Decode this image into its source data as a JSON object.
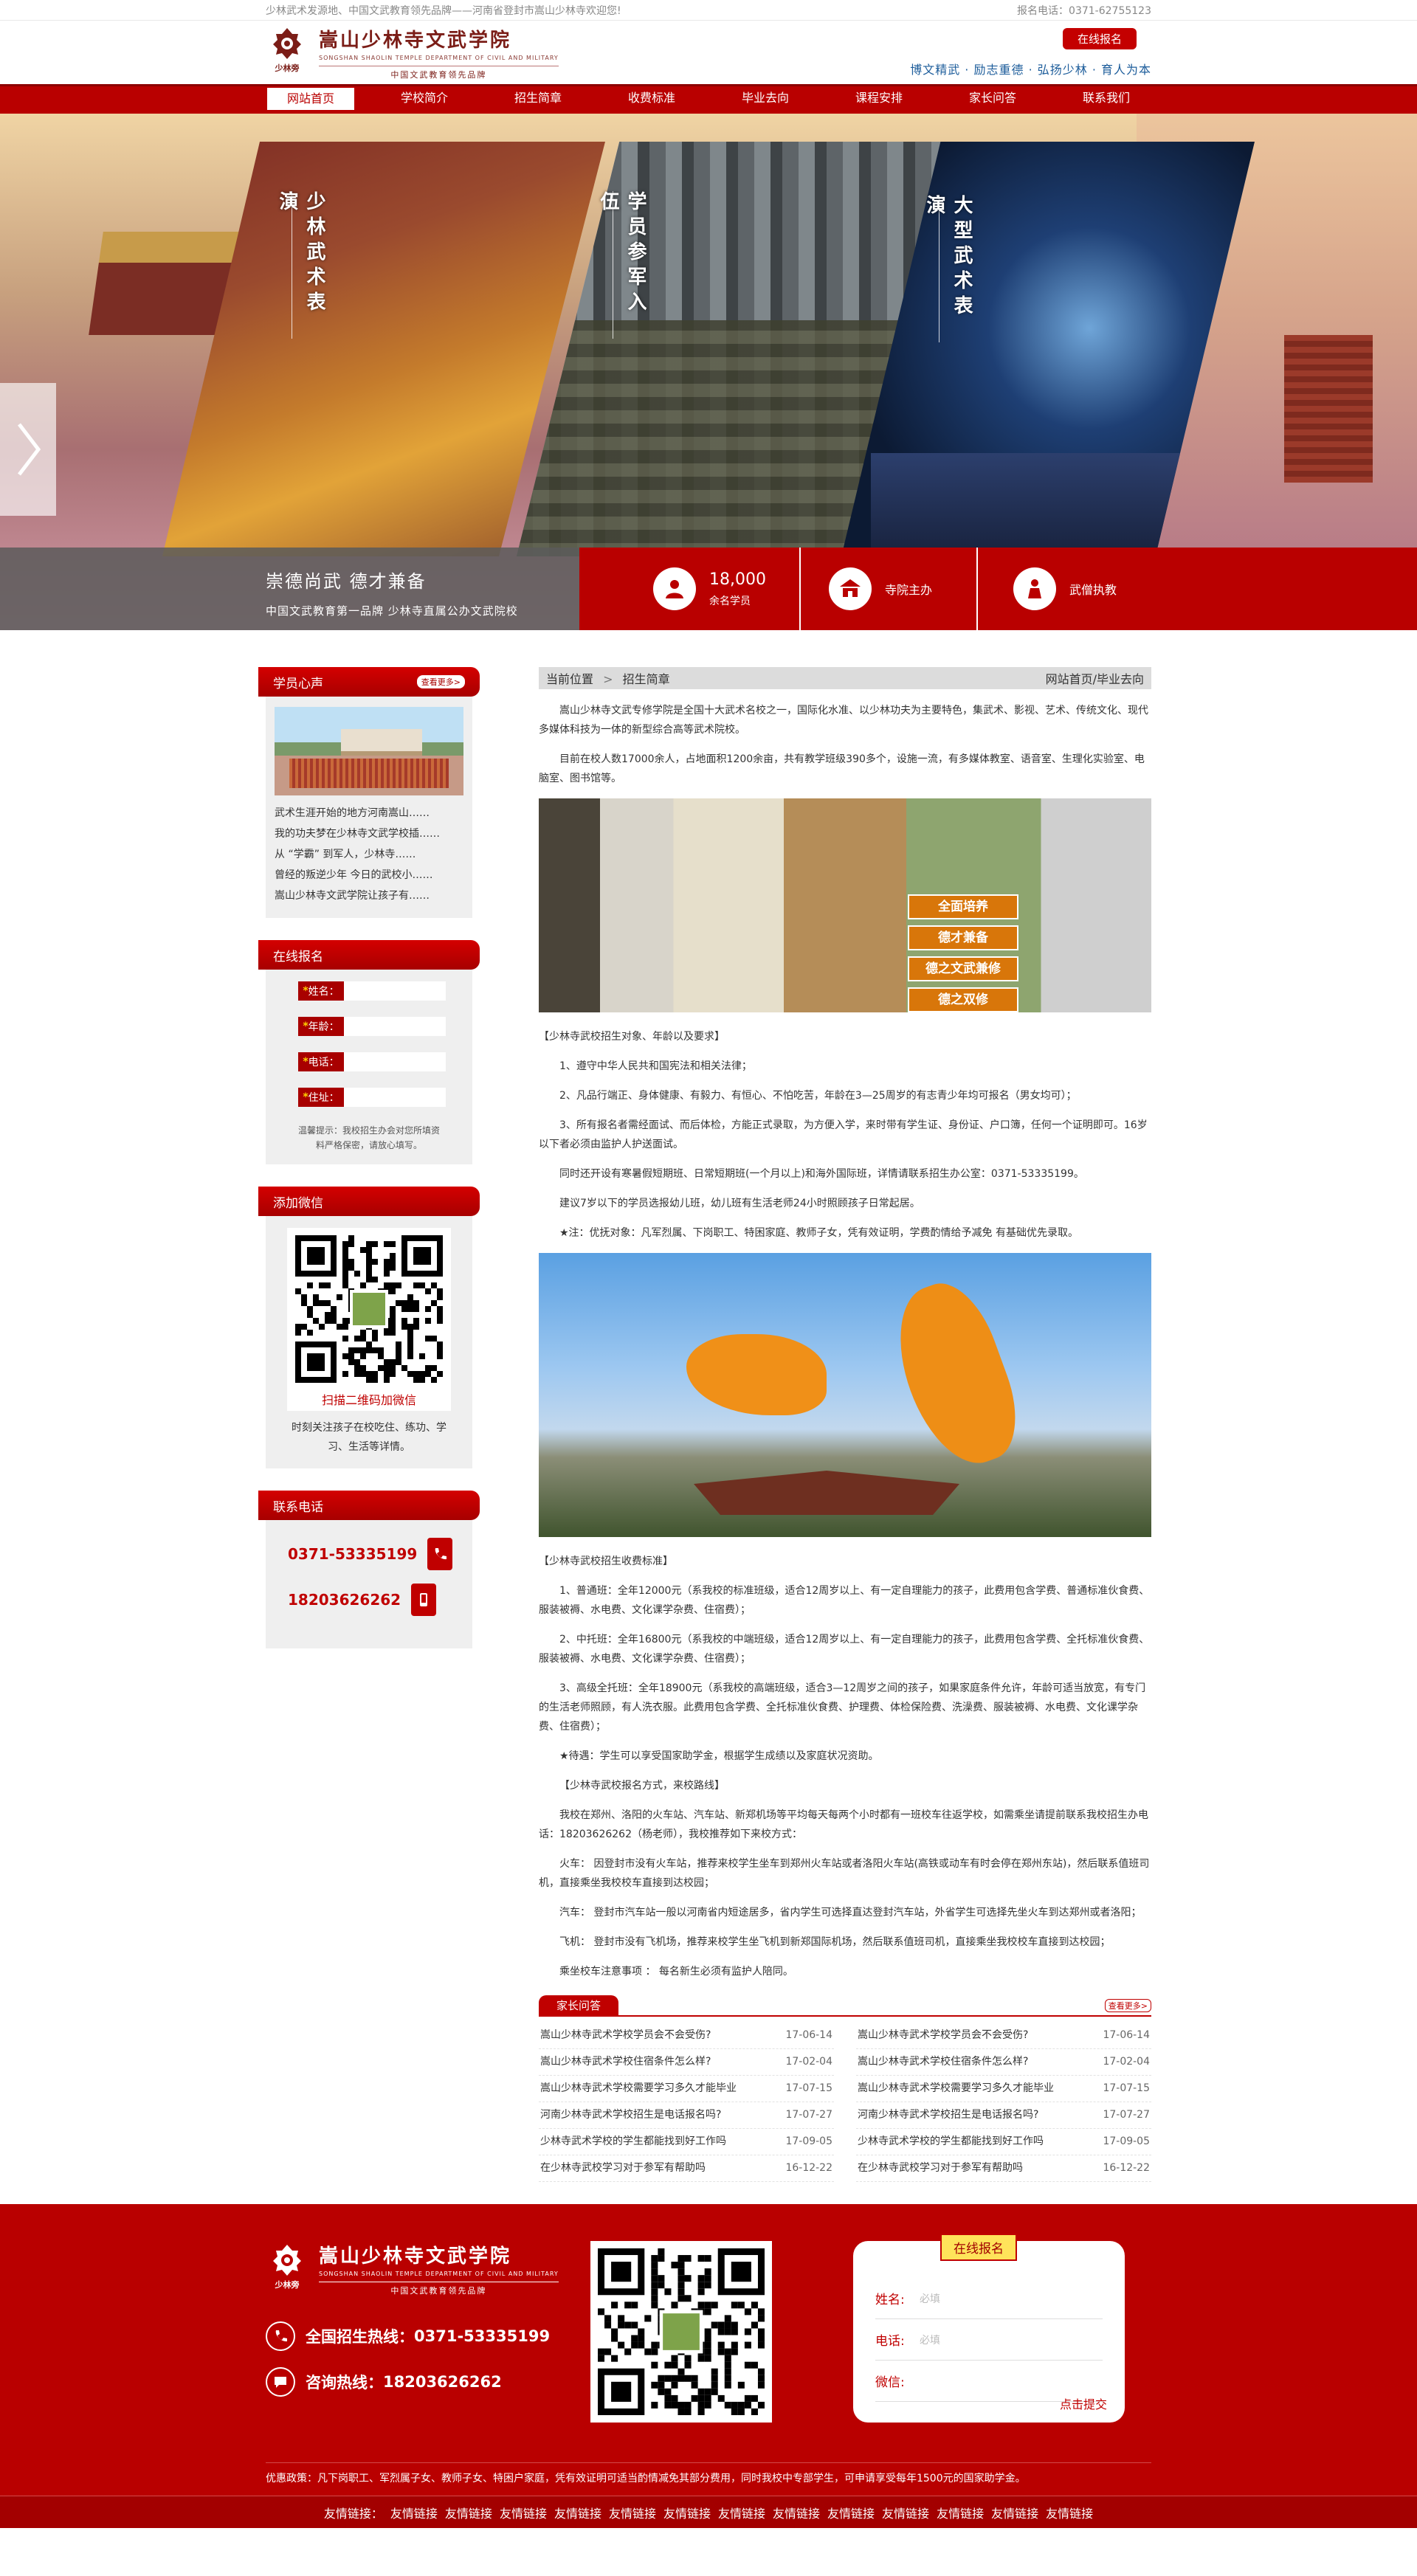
{
  "topbar": {
    "left": "少林武术发源地、中国文武教育领先品牌——河南省登封市嵩山少林寺欢迎您!",
    "right": "报名电话：0371-62755123"
  },
  "header": {
    "school_name": "嵩山少林寺文武学院",
    "school_name_en": "SONGSHAN SHAOLIN TEMPLE DEPARTMENT OF CIVIL AND MILITARY",
    "slogan": "中国文武教育领先品牌",
    "seal_text": "少林旁",
    "apply_label": "在线报名",
    "motto": "博文精武 · 励志重德 · 弘扬少林 · 育人为本"
  },
  "nav": {
    "items": [
      {
        "label": "网站首页"
      },
      {
        "label": "学校简介"
      },
      {
        "label": "招生简章"
      },
      {
        "label": "收费标准"
      },
      {
        "label": "毕业去向"
      },
      {
        "label": "课程安排"
      },
      {
        "label": "家长问答"
      },
      {
        "label": "联系我们"
      }
    ]
  },
  "hero": {
    "panels": [
      {
        "title": "少林武术表演"
      },
      {
        "title": "学员参军入伍"
      },
      {
        "title": "大型武术表演"
      }
    ],
    "tagline": "崇德尚武  德才兼备",
    "subline": "中国文武教育第一品牌    少林寺直属公办文武院校",
    "stat_number": "18,000",
    "stat_label": "余名学员",
    "feature_2": "寺院主办",
    "feature_3": "武僧执教"
  },
  "sidebar": {
    "testimonials": {
      "title": "学员心声",
      "more": "查看更多>",
      "items": [
        "武术生涯开始的地方河南嵩山……",
        "我的功夫梦在少林寺文武学校插……",
        "从 “学霸” 到军人，少林寺……",
        "曾经的叛逆少年 今日的武校小……",
        "嵩山少林寺文武学院让孩子有……"
      ]
    },
    "signup": {
      "title": "在线报名",
      "fields": [
        {
          "label": "姓名："
        },
        {
          "label": "年龄："
        },
        {
          "label": "电话："
        },
        {
          "label": "住址："
        }
      ],
      "required_mark": "*",
      "tip": "温馨提示：我校招生办会对您所填资料严格保密，请放心填写。"
    },
    "wechat": {
      "title": "添加微信",
      "caption": "扫描二维码加微信",
      "desc": "时刻关注孩子在校吃住、练功、学习、生活等详情。"
    },
    "contact": {
      "title": "联系电话",
      "phone1": "0371-53335199",
      "phone2": "18203626262"
    }
  },
  "content": {
    "crumb_label": "当前位置",
    "crumb_current": "招生简章",
    "crumb_right": "网站首页/毕业去向",
    "intro1": "嵩山少林寺文武专修学院是全国十大武术名校之一，国际化水准、以少林功夫为主要特色，集武术、影视、艺术、传统文化、现代多媒体科技为一体的新型综合高等武术院校。",
    "intro2": "目前在校人数17000余人，占地面积1200余亩，共有教学班级390多个，设施一流，有多媒体教室、语音室、生理化实验室、电脑室、图书馆等。",
    "photo1_banners": [
      "全面培养",
      "德才兼备",
      "德之文武兼修",
      "德之双修"
    ],
    "req_title": "【少林寺武校招生对象、年龄以及要求】",
    "req1": "1、遵守中华人民共和国宪法和相关法律；",
    "req2": "2、凡品行端正、身体健康、有毅力、有恒心、不怕吃苦，年龄在3—25周岁的有志青少年均可报名（男女均可）；",
    "req3": "3、所有报名者需经面试、而后体检，方能正式录取，为方便入学，来时带有学生证、身份证、户口簿，任何一个证明即可。16岁以下者必须由监护人护送面试。",
    "req4": "同时还开设有寒暑假短期班、日常短期班(一个月以上)和海外国际班，详情请联系招生办公室：0371-53335199。",
    "req5": "建议7岁以下的学员选报幼儿班，幼儿班有生活老师24小时照顾孩子日常起居。",
    "req6": "★注：优抚对象：凡军烈属、下岗职工、特困家庭、教师子女，凭有效证明，学费酌情给予减免 有基础优先录取。",
    "fee_title": "【少林寺武校招生收费标准】",
    "fee1": "1、普通班：全年12000元（系我校的标准班级，适合12周岁以上、有一定自理能力的孩子，此费用包含学费、普通标准伙食费、服装被褥、水电费、文化课学杂费、住宿费）；",
    "fee2": "2、中托班：全年16800元（系我校的中端班级，适合12周岁以上、有一定自理能力的孩子，此费用包含学费、全托标准伙食费、服装被褥、水电费、文化课学杂费、住宿费）；",
    "fee3": "3、高级全托班：全年18900元（系我校的高端班级，适合3—12周岁之间的孩子，如果家庭条件允许，年龄可适当放宽，有专门的生活老师照顾，有人洗衣服。此费用包含学费、全托标准伙食费、护理费、体检保险费、洗澡费、服装被褥、水电费、文化课学杂费、住宿费）；",
    "fee4": "★待遇：学生可以享受国家助学金，根据学生成绩以及家庭状况资助。",
    "route_title": "【少林寺武校报名方式，来校路线】",
    "route1": "我校在郑州、洛阳的火车站、汽车站、新郑机场等平均每天每两个小时都有一班校车往返学校，如需乘坐请提前联系我校招生办电话：18203626262（杨老师），我校推荐如下来校方式：",
    "route2": "火车：  因登封市没有火车站，推荐来校学生坐车到郑州火车站或者洛阳火车站(高铁或动车有时会停在郑州东站)，然后联系值班司机，直接乘坐我校校车直接到达校园；",
    "route3": "汽车：  登封市汽车站一般以河南省内短途居多，省内学生可选择直达登封汽车站，外省学生可选择先坐火车到达郑州或者洛阳；",
    "route4": "飞机：  登封市没有飞机场，推荐来校学生坐飞机到新郑国际机场，然后联系值班司机，直接乘坐我校校车直接到达校园；",
    "route5": "乘坐校车注意事项 ：  每名新生必须有监护人陪同。",
    "faq_title": "家长问答",
    "faq_more": "查看更多>",
    "faq_left": [
      {
        "q": "嵩山少林寺武术学校学员会不会受伤?",
        "d": "17-06-14"
      },
      {
        "q": "嵩山少林寺武术学校住宿条件怎么样?",
        "d": "17-02-04"
      },
      {
        "q": "嵩山少林寺武术学校需要学习多久才能毕业",
        "d": "17-07-15"
      },
      {
        "q": "河南少林寺武术学校招生是电话报名吗?",
        "d": "17-07-27"
      },
      {
        "q": "少林寺武术学校的学生都能找到好工作吗",
        "d": "17-09-05"
      },
      {
        "q": "在少林寺武校学习对于参军有帮助吗",
        "d": "16-12-22"
      }
    ],
    "faq_right": [
      {
        "q": "嵩山少林寺武术学校学员会不会受伤?",
        "d": "17-06-14"
      },
      {
        "q": "嵩山少林寺武术学校住宿条件怎么样?",
        "d": "17-02-04"
      },
      {
        "q": "嵩山少林寺武术学校需要学习多久才能毕业",
        "d": "17-07-15"
      },
      {
        "q": "河南少林寺武术学校招生是电话报名吗?",
        "d": "17-07-27"
      },
      {
        "q": "少林寺武术学校的学生都能找到好工作吗",
        "d": "17-09-05"
      },
      {
        "q": "在少林寺武校学习对于参军有帮助吗",
        "d": "16-12-22"
      }
    ]
  },
  "footer": {
    "school_name": "嵩山少林寺文武学院",
    "school_name_en": "SONGSHAN SHAOLIN TEMPLE DEPARTMENT OF CIVIL AND MILITARY",
    "slogan": "中国文武教育领先品牌",
    "seal_text": "少林旁",
    "hotline_label": "全国招生热线：",
    "hotline": "0371-53335199",
    "consult_label": "咨询热线：",
    "consult": "18203626262",
    "form_tag": "在线报名",
    "form_fields": [
      {
        "label": "姓名:",
        "placeholder": "必填"
      },
      {
        "label": "电话:",
        "placeholder": "必填"
      },
      {
        "label": "微信:",
        "placeholder": ""
      }
    ],
    "submit": "点击提交",
    "policy": "优惠政策：凡下岗职工、军烈属子女、教师子女、特困户家庭，凭有效证明可适当酌情减免其部分费用，同时我校中专部学生，可申请享受每年1500元的国家助学金。",
    "links_label": "友情链接：",
    "links": [
      "友情链接",
      "友情链接",
      "友情链接",
      "友情链接",
      "友情链接",
      "友情链接",
      "友情链接",
      "友情链接",
      "友情链接",
      "友情链接",
      "友情链接",
      "友情链接",
      "友情链接"
    ]
  },
  "colors": {
    "brand_red": "#b90000",
    "dark_red": "#7b1d17",
    "link_blue": "#1d5d9b"
  }
}
